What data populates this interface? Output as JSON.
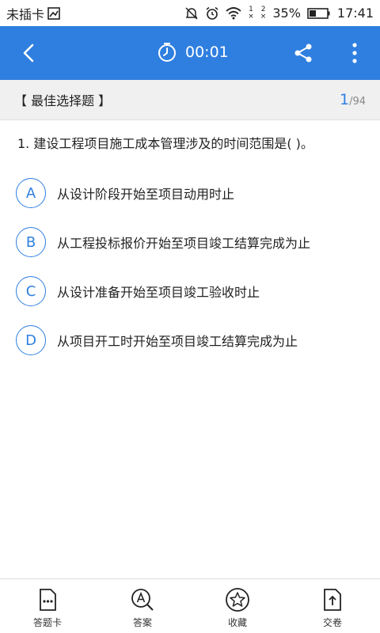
{
  "status_bar": {
    "carrier": "未插卡",
    "sim1": "1",
    "sim2": "2",
    "battery": "35%",
    "time": "17:41",
    "icons": [
      "image-icon",
      "mute-icon",
      "alarm-icon",
      "wifi-icon",
      "sim1-icon",
      "sim2-icon",
      "battery-icon"
    ]
  },
  "app_bar": {
    "timer": "00:01",
    "icons": [
      "back-icon",
      "stopwatch-icon",
      "share-icon",
      "more-icon"
    ]
  },
  "section": {
    "title": "【 最佳选择题 】",
    "current": "1",
    "total": "/94"
  },
  "question": {
    "text": "1. 建设工程项目施工成本管理涉及的时间范围是(   )。",
    "options": [
      {
        "letter": "A",
        "text": "从设计阶段开始至项目动用时止"
      },
      {
        "letter": "B",
        "text": "从工程投标报价开始至项目竣工结算完成为止"
      },
      {
        "letter": "C",
        "text": "从设计准备开始至项目竣工验收时止"
      },
      {
        "letter": "D",
        "text": "从项目开工时开始至项目竣工结算完成为止"
      }
    ]
  },
  "bottom_nav": [
    {
      "label": "答题卡",
      "icon": "answer-sheet-icon"
    },
    {
      "label": "答案",
      "icon": "answer-search-icon"
    },
    {
      "label": "收藏",
      "icon": "star-icon"
    },
    {
      "label": "交卷",
      "icon": "submit-icon"
    }
  ],
  "colors": {
    "accent": "#2f7fe0",
    "header_bg": "#f0f0f0"
  }
}
